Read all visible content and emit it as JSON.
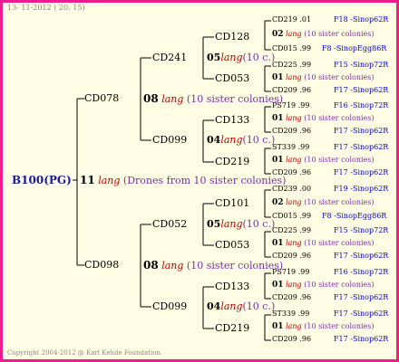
{
  "header_date": "13- 11-2012 ( 20: 15)",
  "footer": "Copyright 2004-2012 @ Karl Kehde Foundation.",
  "root": "B100(PG)",
  "root_link": {
    "count": "11",
    "word": "lang",
    "note": "(Drones from 10 sister colonies)"
  },
  "gen1": [
    {
      "name": "CD078",
      "link": {
        "count": "08",
        "word": "lang",
        "note": "(10 sister colonies)"
      }
    },
    {
      "name": "CD098",
      "link": {
        "count": "08",
        "word": "lang",
        "note": "(10 sister colonies)"
      }
    }
  ],
  "gen2": [
    {
      "name": "CD241",
      "link": {
        "count": "05",
        "word": "lang",
        "note": "(10 c.)"
      }
    },
    {
      "name": "CD099",
      "link": {
        "count": "04",
        "word": "lang",
        "note": "(10 c.)"
      }
    },
    {
      "name": "CD052",
      "link": {
        "count": "05",
        "word": "lang",
        "note": "(10 c.)"
      }
    },
    {
      "name": "CD099",
      "link": {
        "count": "04",
        "word": "lang",
        "note": "(10 c.)"
      }
    }
  ],
  "gen3": [
    {
      "name": "CD128",
      "link": {
        "count": "02",
        "word": "lang",
        "note": "(10 sister colonies)"
      },
      "top": {
        "name": "CD219",
        "year": ".01",
        "origin": "F18 -Sinop62R"
      },
      "bottom": {
        "name": "CD015",
        "year": ".99",
        "origin": "F8 -SinopEgg86R"
      }
    },
    {
      "name": "CD053",
      "link": {
        "count": "01",
        "word": "lang",
        "note": "(10 sister colonies)"
      },
      "top": {
        "name": "CD225",
        "year": ".99",
        "origin": "F15 -Sinop72R"
      },
      "bottom": {
        "name": "CD209",
        "year": ".96",
        "origin": "F17 -Sinop62R"
      }
    },
    {
      "name": "CD133",
      "link": {
        "count": "01",
        "word": "lang",
        "note": "(10 sister colonies)"
      },
      "top": {
        "name": "PS719",
        "year": ".99",
        "origin": "F16 -Sinop72R"
      },
      "bottom": {
        "name": "CD209",
        "year": ".96",
        "origin": "F17 -Sinop62R"
      }
    },
    {
      "name": "CD219",
      "link": {
        "count": "01",
        "word": "lang",
        "note": "(10 sister colonies)"
      },
      "top": {
        "name": "ST339",
        "year": ".99",
        "origin": "F17 -Sinop62R"
      },
      "bottom": {
        "name": "CD209",
        "year": ".96",
        "origin": "F17 -Sinop62R"
      }
    },
    {
      "name": "CD101",
      "link": {
        "count": "02",
        "word": "lang",
        "note": "(10 sister colonies)"
      },
      "top": {
        "name": "CD239",
        "year": ".00",
        "origin": "F19 -Sinop62R"
      },
      "bottom": {
        "name": "CD015",
        "year": ".99",
        "origin": "F8 -SinopEgg86R"
      }
    },
    {
      "name": "CD053",
      "link": {
        "count": "01",
        "word": "lang",
        "note": "(10 sister colonies)"
      },
      "top": {
        "name": "CD225",
        "year": ".99",
        "origin": "F15 -Sinop72R"
      },
      "bottom": {
        "name": "CD209",
        "year": ".96",
        "origin": "F17 -Sinop62R"
      }
    },
    {
      "name": "CD133",
      "link": {
        "count": "01",
        "word": "lang",
        "note": "(10 sister colonies)"
      },
      "top": {
        "name": "PS719",
        "year": ".99",
        "origin": "F16 -Sinop72R"
      },
      "bottom": {
        "name": "CD209",
        "year": ".96",
        "origin": "F17 -Sinop62R"
      }
    },
    {
      "name": "CD219",
      "link": {
        "count": "01",
        "word": "lang",
        "note": "(10 sister colonies)"
      },
      "top": {
        "name": "ST339",
        "year": ".99",
        "origin": "F17 -Sinop62R"
      },
      "bottom": {
        "name": "CD209",
        "year": ".96",
        "origin": "F17 -Sinop62R"
      }
    }
  ]
}
